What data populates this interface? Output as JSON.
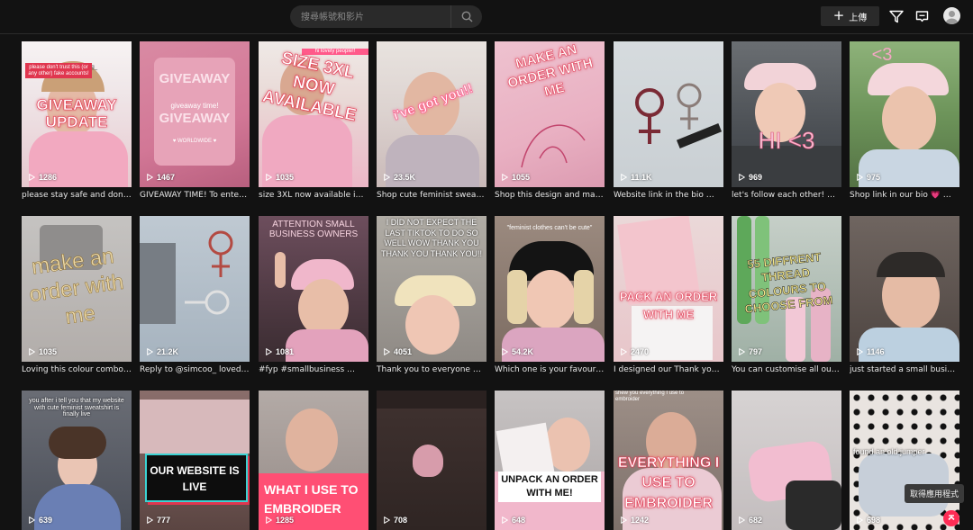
{
  "header": {
    "search_placeholder": "搜尋帳號和影片",
    "upload_label": "上傳"
  },
  "videos": [
    {
      "views": "1286",
      "caption": "please stay safe and don't…"
    },
    {
      "views": "1467",
      "caption": "GIVEAWAY TIME! To ente…"
    },
    {
      "views": "1035",
      "caption": "size 3XL now available in t…"
    },
    {
      "views": "23.5K",
      "caption": "Shop cute feminist sweats…"
    },
    {
      "views": "1055",
      "caption": "Shop this design and man…"
    },
    {
      "views": "11.1K",
      "caption": "Website link in the bio 🫶…"
    },
    {
      "views": "969",
      "caption": "let's follow each other! …"
    },
    {
      "views": "975",
      "caption": "Shop link in our bio 💗 …"
    },
    {
      "views": "1035",
      "caption": "Loving this colour combo!!…"
    },
    {
      "views": "21.2K",
      "caption": "Reply to @simcoo_ loved …"
    },
    {
      "views": "1081",
      "caption": "#fyp #smallbusiness …"
    },
    {
      "views": "4051",
      "caption": "Thank you to everyone wh…"
    },
    {
      "views": "54.2K",
      "caption": "Which one is your favourit…"
    },
    {
      "views": "2470",
      "caption": "I designed our Thank you …"
    },
    {
      "views": "797",
      "caption": "You can customise all our …"
    },
    {
      "views": "1146",
      "caption": "just started a small busine…"
    },
    {
      "views": "639",
      "caption": ""
    },
    {
      "views": "777",
      "caption": ""
    },
    {
      "views": "1285",
      "caption": ""
    },
    {
      "views": "708",
      "caption": ""
    },
    {
      "views": "648",
      "caption": ""
    },
    {
      "views": "1242",
      "caption": ""
    },
    {
      "views": "682",
      "caption": ""
    },
    {
      "views": "698",
      "caption": ""
    }
  ],
  "overlays": {
    "v1_top": "@loversclothing_",
    "v1_note": "please don't trust this (or any other) fake accounts!",
    "v1_big": "GIVEAWAY UPDATE",
    "v2_a": "GIVEAWAY",
    "v2_b": "giveaway time!",
    "v2_c": "GIVEAWAY",
    "v2_d": "♥ WORLDWIDE ♥",
    "v3_top": "hi lovely people!!",
    "v3_big": "SIZE 3XL NOW AVAILABLE",
    "v4_big": "i've got you!!",
    "v5_big": "MAKE AN ORDER WITH ME",
    "v7_big": "HI <3",
    "v8_big": "<3",
    "v9_big": "make an order with me",
    "v11_top": "ATTENTION SMALL BUSINESS OWNERS",
    "v12_top": "I DID NOT EXPECT THE LAST TIKTOK TO DO SO WELL WOW THANK YOU THANK YOU THANK YOU!!",
    "v13_top": "\"feminist clothes can't be cute\"",
    "v14_big": "PACK AN ORDER WITH ME",
    "v15_big": "55 DIFFRENT THREAD COLOURS TO CHOOSE FROM",
    "v17_top": "you after i tell you that my website with cute feminist sweatshirt is finally live",
    "v18_big": "OUR WEBSITE IS LIVE",
    "v19_big": "WHAT I USE TO EMBROIDER",
    "v21_big": "UNPACK AN ORDER WITH ME!",
    "v22_top": "shew you everything I use to embroider",
    "v22_big": "EVERYTHING I USE TO EMBROIDER",
    "v24_top": "found an old jumper"
  },
  "float_chip": "取得應用程式",
  "icons": {
    "search": "search-icon",
    "upload": "plus-icon",
    "filter": "filter-icon",
    "inbox": "inbox-icon",
    "profile": "avatar",
    "play": "play-icon",
    "back_to_top": "arrow-up-icon"
  },
  "colors": {
    "background": "#121212",
    "accent": "#fe2c55",
    "overlay_pink": "#ff4f86",
    "overlay_yellow": "#f7e8a0"
  }
}
